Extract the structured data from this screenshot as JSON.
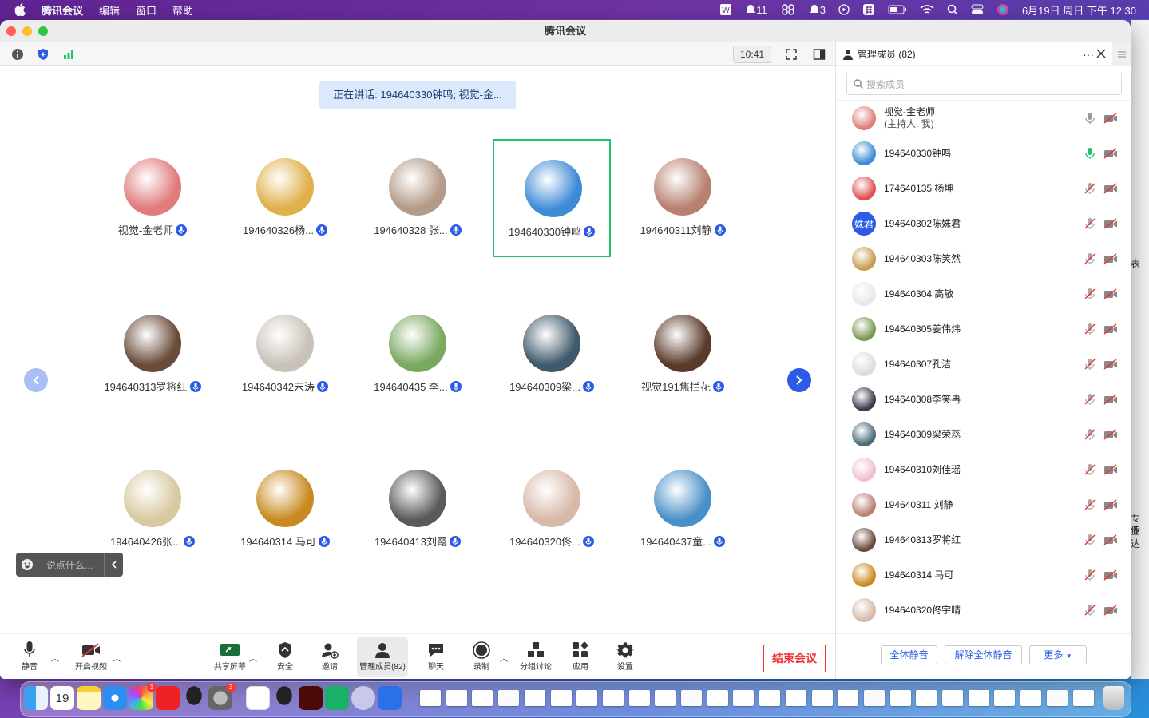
{
  "menubar": {
    "app_name": "腾讯会议",
    "menus": [
      "编辑",
      "窗口",
      "帮助"
    ],
    "notif1_count": "11",
    "notif2_count": "3",
    "clock": "6月19日 周日 下午 12:30"
  },
  "window": {
    "title": "腾讯会议",
    "timer": "10:41"
  },
  "stage": {
    "speaking": "正在讲话: 194640330钟鸣; 视觉-金...",
    "tiles": [
      {
        "name": "视觉-金老师",
        "color": "#e07c7c"
      },
      {
        "name": "194640326杨...",
        "color": "#e0b04a"
      },
      {
        "name": "194640328 张...",
        "color": "#b49a88"
      },
      {
        "name": "194640330钟鸣",
        "color": "#3d8ad6"
      },
      {
        "name": "194640311刘静",
        "color": "#b88070"
      },
      {
        "name": "194640313罗将红",
        "color": "#6a4b3a"
      },
      {
        "name": "194640342宋涛",
        "color": "#c9c2b8"
      },
      {
        "name": "194640435 李...",
        "color": "#7aa860"
      },
      {
        "name": "194640309梁...",
        "color": "#3f5a6a"
      },
      {
        "name": "视觉191焦拦花",
        "color": "#5a3a2a"
      },
      {
        "name": "194640426张...",
        "color": "#d7c9a0"
      },
      {
        "name": "194640314 马可",
        "color": "#c88a20"
      },
      {
        "name": "194640413刘霞",
        "color": "#5a5a5a"
      },
      {
        "name": "194640320佟...",
        "color": "#d8b8a8"
      },
      {
        "name": "194640437童...",
        "color": "#4a90c8"
      }
    ],
    "chat_placeholder": "说点什么..."
  },
  "bottombar": {
    "mute": "静音",
    "video": "开启视频",
    "share": "共享屏幕",
    "security": "安全",
    "invite": "邀请",
    "members": "管理成员(82)",
    "chat": "聊天",
    "record": "录制",
    "breakout": "分组讨论",
    "apps": "应用",
    "settings": "设置",
    "end": "结束会议"
  },
  "panel": {
    "title": "管理成员 (82)",
    "search_placeholder": "搜索成员",
    "members": [
      {
        "name": "视觉-金老师",
        "sub": "(主持人, 我)",
        "color": "#e07c7c",
        "initials": "",
        "mic_state": "muted-grey"
      },
      {
        "name": "194640330钟鸣",
        "sub": "",
        "color": "#3d8ad6",
        "initials": "",
        "mic_state": "speaking"
      },
      {
        "name": "174640135 杨坤",
        "sub": "",
        "color": "#e05050",
        "initials": "",
        "mic_state": "muted"
      },
      {
        "name": "194640302陈姝君",
        "sub": "",
        "color": "#2c5be6",
        "initials": "姝君",
        "mic_state": "muted"
      },
      {
        "name": "194640303陈笑然",
        "sub": "",
        "color": "#c89a50",
        "initials": "",
        "mic_state": "muted"
      },
      {
        "name": "194640304 高敏",
        "sub": "",
        "color": "#e8e8e8",
        "initials": "",
        "mic_state": "muted"
      },
      {
        "name": "194640305姜伟炜",
        "sub": "",
        "color": "#7a9a50",
        "initials": "",
        "mic_state": "muted"
      },
      {
        "name": "194640307孔洁",
        "sub": "",
        "color": "#dcdcdc",
        "initials": "",
        "mic_state": "muted"
      },
      {
        "name": "194640308李笑冉",
        "sub": "",
        "color": "#3a3a4a",
        "initials": "",
        "mic_state": "muted"
      },
      {
        "name": "194640309梁荣蕊",
        "sub": "",
        "color": "#4a6a7a",
        "initials": "",
        "mic_state": "muted"
      },
      {
        "name": "194640310刘佳瑶",
        "sub": "",
        "color": "#f0c0d0",
        "initials": "",
        "mic_state": "muted"
      },
      {
        "name": "194640311 刘静",
        "sub": "",
        "color": "#b88070",
        "initials": "",
        "mic_state": "muted"
      },
      {
        "name": "194640313罗将红",
        "sub": "",
        "color": "#6a4b3a",
        "initials": "",
        "mic_state": "muted"
      },
      {
        "name": "194640314 马可",
        "sub": "",
        "color": "#c88a20",
        "initials": "",
        "mic_state": "muted"
      },
      {
        "name": "194640320佟宇晴",
        "sub": "",
        "color": "#d8b8a8",
        "initials": "",
        "mic_state": "muted"
      }
    ],
    "mute_all": "全体静音",
    "unmute_all": "解除全体静音",
    "more": "更多"
  },
  "sliver_text": [
    "表",
    "专业",
    "传达"
  ],
  "dock": {
    "calendar_day": "19",
    "badge1": "1",
    "badge2": "3"
  }
}
